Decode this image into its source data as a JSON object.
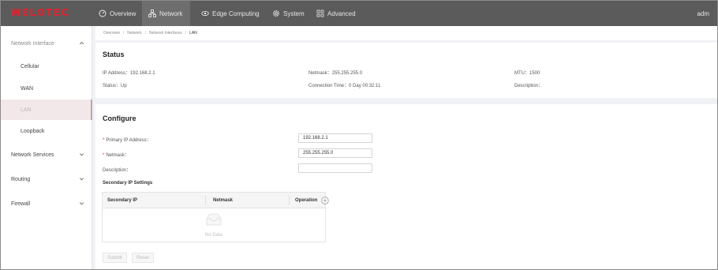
{
  "brand": {
    "logo_text": "WELOTEC",
    "accent": "#e8202a"
  },
  "topnav": {
    "items": [
      {
        "label": "Overview",
        "icon": "dashboard-icon"
      },
      {
        "label": "Network",
        "icon": "network-icon"
      },
      {
        "label": "Edge Computing",
        "icon": "edge-computing-icon"
      },
      {
        "label": "System",
        "icon": "gear-icon"
      },
      {
        "label": "Advanced",
        "icon": "grid-icon"
      }
    ],
    "active": "Network",
    "user": "adm"
  },
  "sidebar": {
    "network_interface": "Network Interface",
    "sub_items": [
      "Cellular",
      "WAN",
      "LAN",
      "Loopback"
    ],
    "active_sub": "LAN",
    "groups": [
      "Network Services",
      "Routing",
      "Firewall"
    ]
  },
  "breadcrumb": {
    "items": [
      "Overview",
      "Network",
      "Network Interfaces",
      "LAN"
    ],
    "separator": "/"
  },
  "status": {
    "title": "Status",
    "ip_label": "IP Address：",
    "ip_value": "192.168.2.1",
    "netmask_label": "Netmask：",
    "netmask_value": "255.255.255.0",
    "mtu_label": "MTU：",
    "mtu_value": "1500",
    "status_label": "Status：",
    "status_value": "Up",
    "conn_label": "Connection Time：",
    "conn_value": "0 Day 00:32:11",
    "desc_label": "Description：",
    "desc_value": ""
  },
  "configure": {
    "title": "Configure",
    "primary_ip_label": "Primary IP Address：",
    "primary_ip_value": "192.168.2.1",
    "netmask_label": "Netmask：",
    "netmask_value": "255.255.255.0",
    "description_label": "Description：",
    "description_value": "",
    "secondary_title": "Secondary IP Settings",
    "table": {
      "headers": [
        "Secondary IP",
        "Netmask",
        "Operation"
      ],
      "rows": [],
      "empty_text": "No Data"
    },
    "submit_label": "Submit",
    "reset_label": "Reset"
  }
}
